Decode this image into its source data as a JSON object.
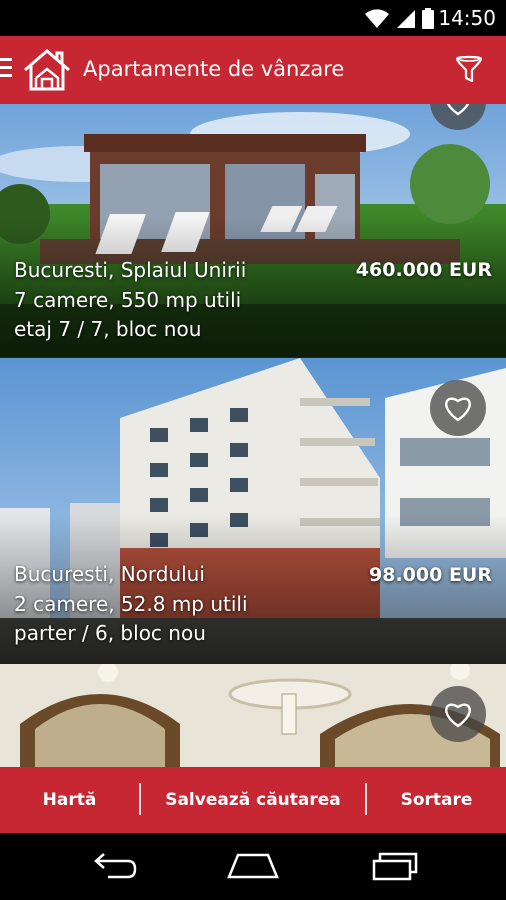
{
  "status_bar": {
    "time": "14:50",
    "icons": [
      "wifi-icon",
      "signal-icon",
      "battery-icon"
    ]
  },
  "app_bar": {
    "title": "Apartamente de vânzare",
    "icons": [
      "menu-icon",
      "house-logo-icon",
      "filter-icon"
    ],
    "color": "#c62733"
  },
  "listings": [
    {
      "location": "Bucuresti, Splaiul Unirii",
      "rooms_area": "7 camere, 550 mp utili",
      "floor": "etaj 7 / 7, bloc nou",
      "price": "460.000 EUR",
      "favorite_icon": "heart-icon"
    },
    {
      "location": "Bucuresti, Nordului",
      "rooms_area": "2 camere, 52.8 mp utili",
      "floor": "parter / 6, bloc nou",
      "price": "98.000 EUR",
      "favorite_icon": "heart-icon"
    },
    {
      "location": "",
      "rooms_area": "",
      "floor": "",
      "price": "",
      "favorite_icon": "heart-icon"
    }
  ],
  "action_bar": {
    "map_label": "Hartă",
    "save_search_label": "Salvează căutarea",
    "sort_label": "Sortare"
  },
  "nav_bar": {
    "icons": [
      "back-icon",
      "home-icon",
      "recents-icon"
    ]
  }
}
